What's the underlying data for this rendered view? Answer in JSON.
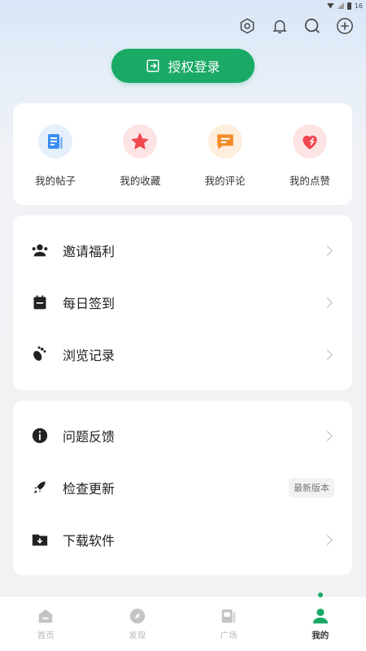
{
  "status_bar": {
    "time_fragment": "16"
  },
  "header_icons": [
    "settings-icon",
    "bell-icon",
    "search-icon",
    "add-icon"
  ],
  "login_button": {
    "label": "授权登录",
    "color": "#1aaa66"
  },
  "quick_actions": [
    {
      "label": "我的帖子",
      "icon": "post-icon",
      "color": "#3a8ef0"
    },
    {
      "label": "我的收藏",
      "icon": "star-icon",
      "color": "#f0474f"
    },
    {
      "label": "我的评论",
      "icon": "comment-icon",
      "color": "#f58a27"
    },
    {
      "label": "我的点赞",
      "icon": "heart-icon",
      "color": "#f0474f"
    }
  ],
  "menu_group_1": [
    {
      "label": "邀请福利",
      "icon": "invite-icon"
    },
    {
      "label": "每日签到",
      "icon": "calendar-icon"
    },
    {
      "label": "浏览记录",
      "icon": "footprint-icon"
    }
  ],
  "menu_group_2": [
    {
      "label": "问题反馈",
      "icon": "info-icon"
    },
    {
      "label": "检查更新",
      "icon": "rocket-icon",
      "badge": "最新版本"
    },
    {
      "label": "下载软件",
      "icon": "download-folder-icon"
    }
  ],
  "tabs": [
    {
      "label": "首页",
      "icon": "home-icon"
    },
    {
      "label": "发现",
      "icon": "compass-icon"
    },
    {
      "label": "广场",
      "icon": "square-icon"
    },
    {
      "label": "我的",
      "icon": "person-icon",
      "active": true
    }
  ]
}
